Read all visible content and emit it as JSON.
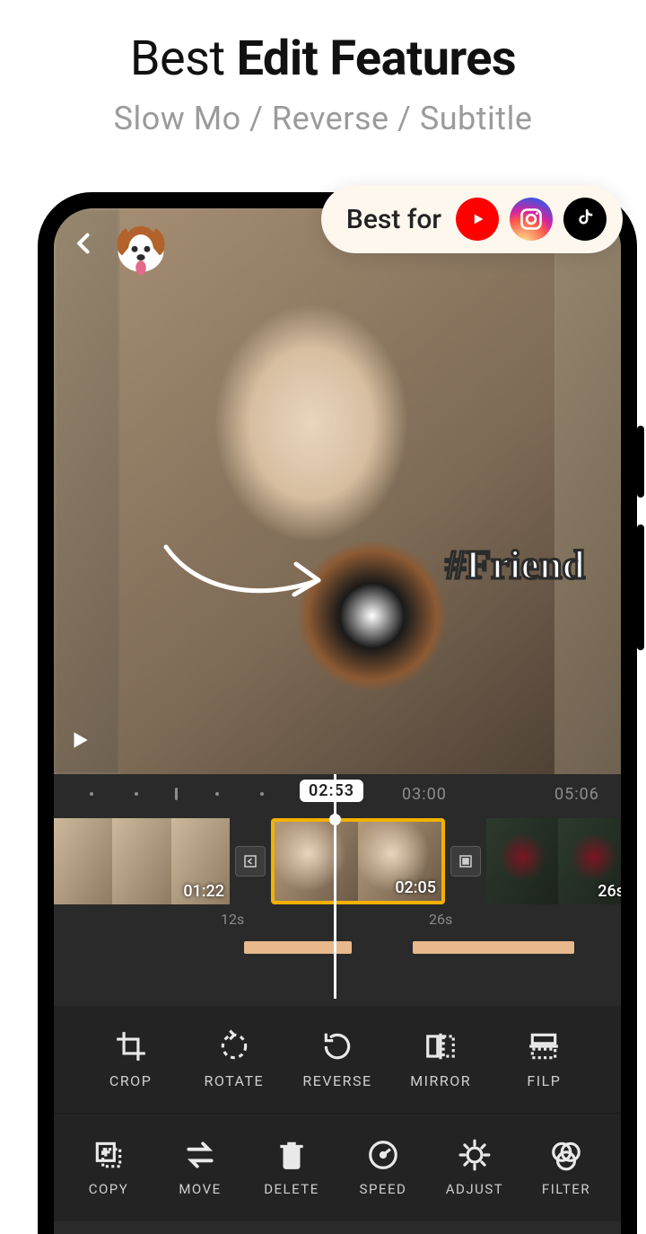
{
  "headline": {
    "pre": "Best ",
    "bold": "Edit Features"
  },
  "subhead": "Slow Mo / Reverse / Subtitle",
  "bestfor": {
    "label": "Best for",
    "brands": [
      "youtube",
      "instagram",
      "tiktok"
    ]
  },
  "preview": {
    "sticker": "dog-sticker",
    "hashtag": "#Friend"
  },
  "timeline": {
    "current": "02:53",
    "marker_a": "03:00",
    "marker_b": "05:06",
    "clips": [
      {
        "duration": "01:22",
        "segment_label": "12s"
      },
      {
        "duration": "02:05",
        "segment_label": "26s"
      },
      {
        "duration": "26s",
        "segment_label": ""
      }
    ]
  },
  "tools_row1": [
    {
      "id": "crop",
      "label": "CROP"
    },
    {
      "id": "rotate",
      "label": "ROTATE"
    },
    {
      "id": "reverse",
      "label": "REVERSE"
    },
    {
      "id": "mirror",
      "label": "MIRROR"
    },
    {
      "id": "flip",
      "label": "FILP"
    }
  ],
  "tools_row2": [
    {
      "id": "copy",
      "label": "COPY"
    },
    {
      "id": "move",
      "label": "MOVE"
    },
    {
      "id": "delete",
      "label": "DELETE"
    },
    {
      "id": "speed",
      "label": "SPEED"
    },
    {
      "id": "adjust",
      "label": "ADJUST"
    },
    {
      "id": "filter",
      "label": "FILTER"
    }
  ]
}
